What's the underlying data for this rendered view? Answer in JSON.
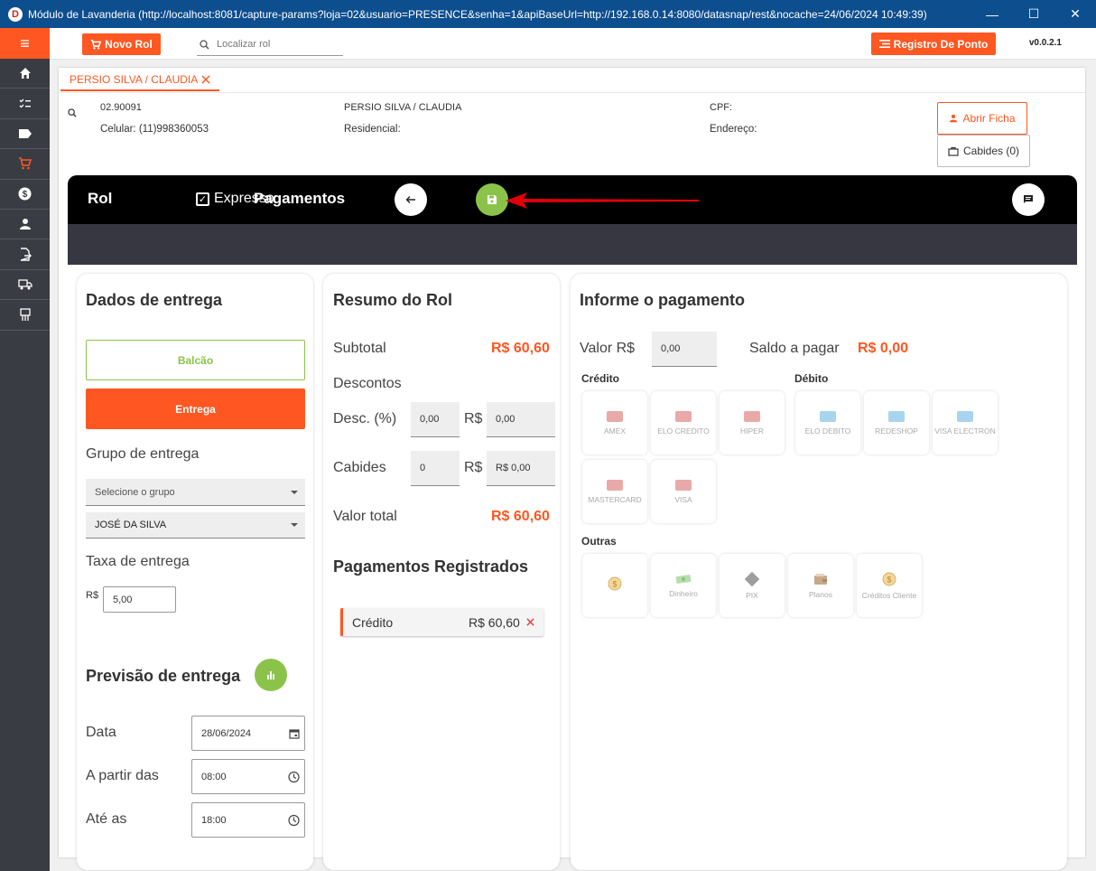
{
  "window": {
    "title": "Módulo de Lavanderia (http://localhost:8081/capture-params?loja=02&usuario=PRESENCE&senha=1&apiBaseUrl=http://192.168.0.14:8080/datasnap/rest&nocache=24/06/2024 10:49:39)",
    "icon_letter": "D",
    "minimize": "—",
    "maximize": "☐",
    "close": "✕"
  },
  "sidebar": {
    "menu_icon": "≡",
    "items": [
      "home-icon",
      "checklist-icon",
      "tag-icon",
      "cart-icon",
      "dollar-icon",
      "person-icon",
      "export-doc-icon",
      "truck-icon",
      "hanger-icon"
    ],
    "active_index": 3
  },
  "topbar": {
    "new_rol": "Novo Rol",
    "search_placeholder": "Localizar rol",
    "registro_ponto": "Registro De Ponto",
    "version": "v0.0.2.1"
  },
  "tab": {
    "label": "PERSIO SILVA / CLAUDIA"
  },
  "client": {
    "code": "02.90091",
    "celular": "Celular: (11)998360053",
    "name": "PERSIO SILVA / CLAUDIA",
    "residencial": "Residencial:",
    "cpf": "CPF:",
    "endereco": "Endereço:",
    "abrir_ficha": "Abrir Ficha",
    "cabides": "Cabides (0)"
  },
  "header": {
    "rol": "Rol",
    "expresso": "Expresso",
    "expresso_checked": true,
    "pagamentos": "Pagamentos"
  },
  "entrega": {
    "title": "Dados de entrega",
    "balcao": "Balcão",
    "entrega": "Entrega",
    "grupo_label": "Grupo de entrega",
    "grupo_placeholder": "Selecione o grupo",
    "pessoa": "JOSÉ DA SILVA",
    "taxa_label": "Taxa de entrega",
    "taxa_currency": "R$",
    "taxa_value": "5,00",
    "previsao": "Previsão de entrega",
    "data_label": "Data",
    "data_value": "28/06/2024",
    "apartir_label": "A partir das",
    "apartir_value": "08:00",
    "ate_label": "Até as",
    "ate_value": "18:00"
  },
  "resumo": {
    "title": "Resumo do Rol",
    "subtotal_label": "Subtotal",
    "subtotal": "R$ 60,60",
    "descontos": "Descontos",
    "desc_label": "Desc. (%)",
    "desc_pct": "0,00",
    "currency": "R$",
    "desc_value": "0,00",
    "cabides_label": "Cabides",
    "cabides_qty": "0",
    "cabides_value": "R$ 0,00",
    "total_label": "Valor total",
    "total": "R$ 60,60",
    "registrados_title": "Pagamentos Registrados",
    "registrado_tipo": "Crédito",
    "registrado_valor": "R$ 60,60"
  },
  "pagamento": {
    "title": "Informe o pagamento",
    "valor_label": "Valor R$",
    "valor": "0,00",
    "saldo_label": "Saldo a pagar",
    "saldo": "R$ 0,00",
    "credito": "Crédito",
    "debito": "Débito",
    "outras": "Outras",
    "credito_items": [
      "AMEX",
      "ELO CREDITO",
      "HIPER",
      "MASTERCARD",
      "VISA"
    ],
    "debito_items": [
      "ELO DEBITO",
      "REDESHOP",
      "VISA ELECTRON"
    ],
    "outras_items": [
      "",
      "Dinheiro",
      "PIX",
      "Planos",
      "Créditos Cliente"
    ]
  },
  "colors": {
    "accent": "#fe5722",
    "green": "#8bc34a",
    "sidebar": "#3a3c43",
    "titlebar": "#0d4e8e"
  }
}
